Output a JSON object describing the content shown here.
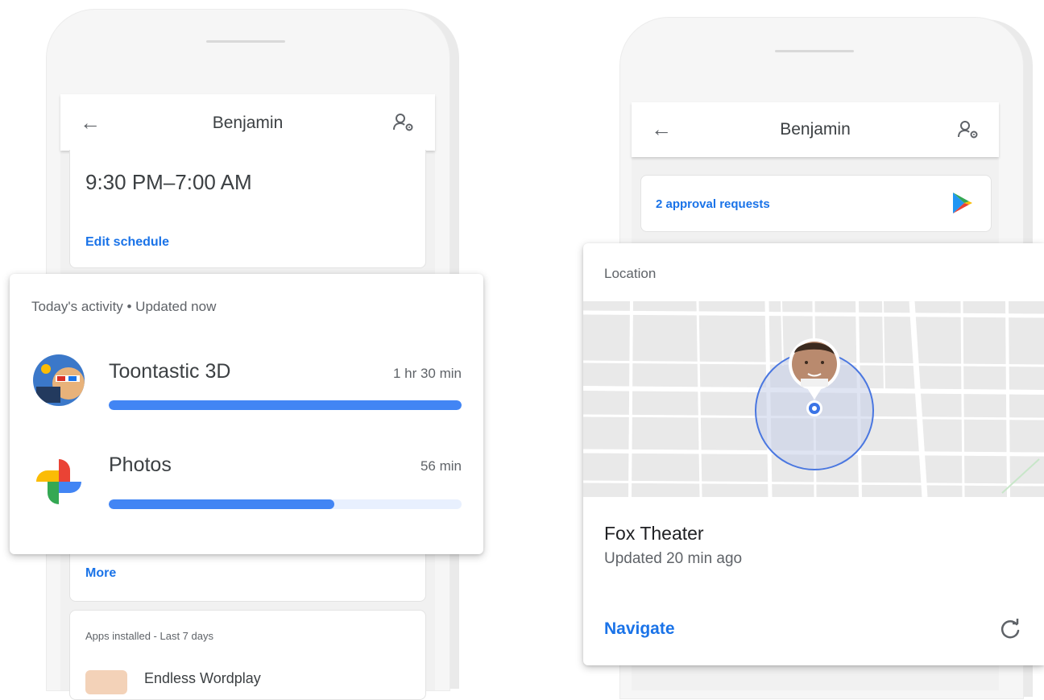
{
  "left_phone": {
    "appbar_title": "Benjamin",
    "schedule_time": "9:30 PM–7:00 AM",
    "edit_schedule": "Edit schedule",
    "more_link": "More",
    "apps_installed_header": "Apps installed - Last 7 days",
    "apps_installed_first": "Endless Wordplay"
  },
  "activity_card": {
    "header": "Today's activity • Updated now",
    "apps": [
      {
        "name": "Toontastic 3D",
        "duration": "1 hr 30 min",
        "progress": 1.0
      },
      {
        "name": "Photos",
        "duration": "56 min",
        "progress": 0.64
      }
    ]
  },
  "right_phone": {
    "appbar_title": "Benjamin",
    "approval_requests": "2 approval requests"
  },
  "location_card": {
    "header": "Location",
    "place": "Fox Theater",
    "updated": "Updated 20 min ago",
    "navigate": "Navigate"
  },
  "icons": {
    "back": "arrow-left-icon",
    "settings": "person-settings-icon",
    "play_store": "play-store-icon",
    "refresh": "refresh-icon"
  },
  "colors": {
    "accent": "#1a73e8",
    "bar": "#4285f4",
    "bar_track": "#e8f0fe"
  }
}
